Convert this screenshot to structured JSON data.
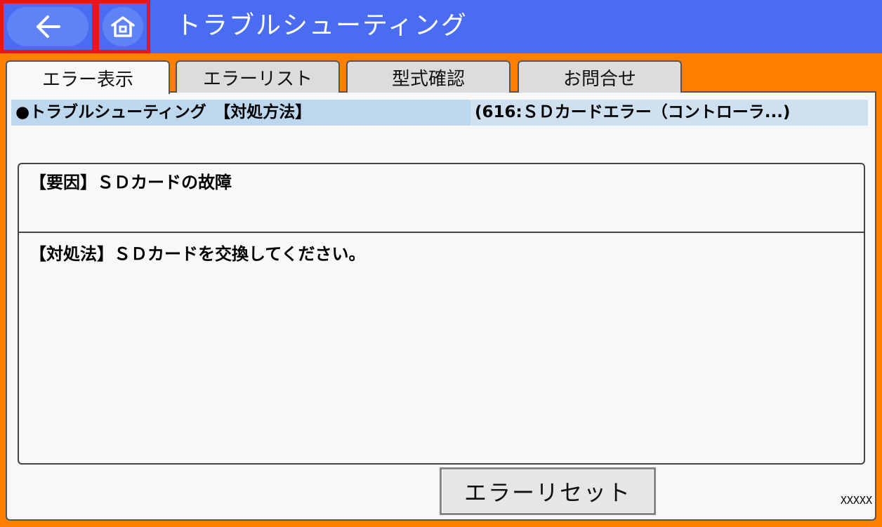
{
  "header": {
    "title": "トラブルシューティング",
    "back_icon": "arrow-left-icon",
    "home_icon": "home-icon"
  },
  "tabs": [
    {
      "label": "エラー表示",
      "active": true
    },
    {
      "label": "エラーリスト",
      "active": false
    },
    {
      "label": "型式確認",
      "active": false
    },
    {
      "label": "お問合せ",
      "active": false
    }
  ],
  "info": {
    "left": "●トラブルシューティング　【対処方法】",
    "right": "(616:ＳＤカードエラー（コントローラ...)"
  },
  "detail": {
    "cause": "【要因】ＳＤカードの故障",
    "action": "【対処法】ＳＤカードを交換してください。"
  },
  "footer": {
    "reset_label": "エラーリセット",
    "code": "XXXXX"
  },
  "colors": {
    "background": "#ff8000",
    "header": "#4a6cf0",
    "highlight_border": "#e8141e",
    "info_bar": "#bdd7ee"
  }
}
